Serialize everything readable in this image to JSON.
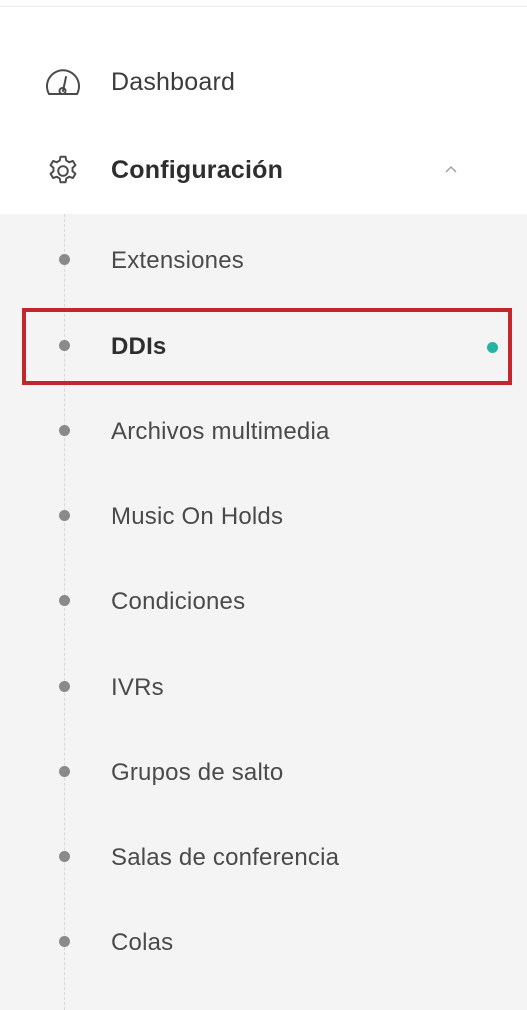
{
  "nav": {
    "dashboard": {
      "label": "Dashboard",
      "icon": "dashboard-gauge-icon"
    },
    "configuracion": {
      "label": "Configuración",
      "icon": "gear-icon",
      "expanded": true,
      "chevron_icon": "chevron-up-icon",
      "subitems": [
        {
          "label": "Extensiones"
        },
        {
          "label": "DDIs",
          "active": true
        },
        {
          "label": "Archivos multimedia"
        },
        {
          "label": "Music On Holds"
        },
        {
          "label": "Condiciones"
        },
        {
          "label": "IVRs"
        },
        {
          "label": "Grupos de salto"
        },
        {
          "label": "Salas de conferencia"
        },
        {
          "label": "Colas"
        }
      ]
    }
  },
  "colors": {
    "active_indicator": "#26b3a3",
    "highlight_box": "#c1272d",
    "submenu_bg": "#f4f4f4"
  }
}
